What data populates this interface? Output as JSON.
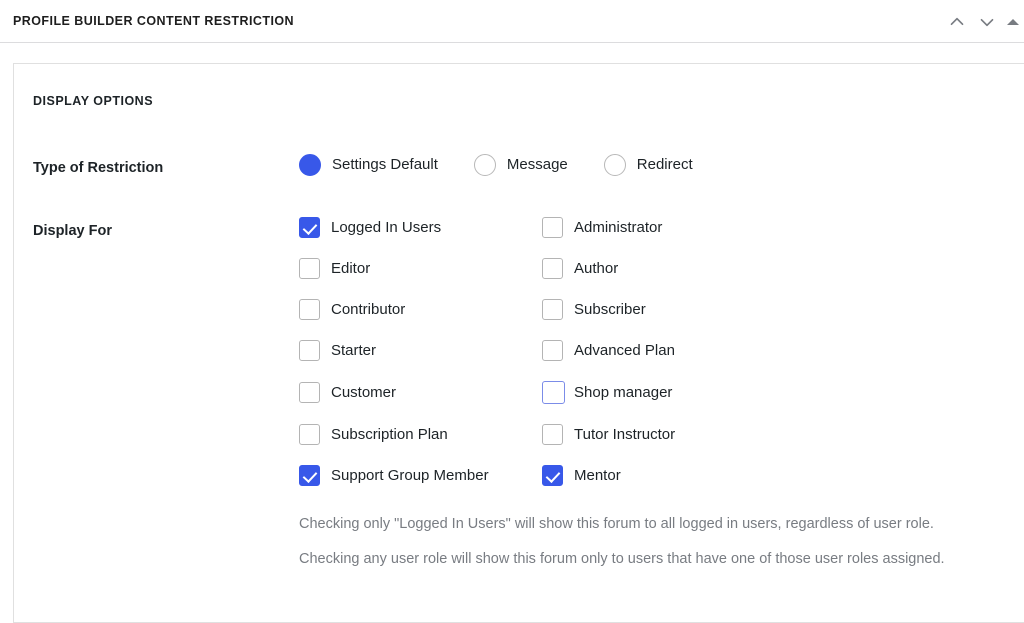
{
  "metabox": {
    "title": "PROFILE BUILDER CONTENT RESTRICTION",
    "controls": [
      {
        "name": "move-up-icon",
        "label": "Move up"
      },
      {
        "name": "move-down-icon",
        "label": "Move down"
      },
      {
        "name": "toggle-panel-icon",
        "label": "Toggle panel"
      }
    ]
  },
  "panel": {
    "section_heading": "DISPLAY OPTIONS",
    "restriction": {
      "label": "Type of Restriction",
      "options": [
        {
          "label": "Settings Default",
          "checked": true
        },
        {
          "label": "Message",
          "checked": false
        },
        {
          "label": "Redirect",
          "checked": false
        }
      ]
    },
    "display_for": {
      "label": "Display For",
      "roles": [
        {
          "label": "Logged In Users",
          "checked": true,
          "focused": false
        },
        {
          "label": "Administrator",
          "checked": false,
          "focused": false
        },
        {
          "label": "Editor",
          "checked": false,
          "focused": false
        },
        {
          "label": "Author",
          "checked": false,
          "focused": false
        },
        {
          "label": "Contributor",
          "checked": false,
          "focused": false
        },
        {
          "label": "Subscriber",
          "checked": false,
          "focused": false
        },
        {
          "label": "Starter",
          "checked": false,
          "focused": false
        },
        {
          "label": "Advanced Plan",
          "checked": false,
          "focused": false
        },
        {
          "label": "Customer",
          "checked": false,
          "focused": false
        },
        {
          "label": "Shop manager",
          "checked": false,
          "focused": true
        },
        {
          "label": "Subscription Plan",
          "checked": false,
          "focused": false
        },
        {
          "label": "Tutor Instructor",
          "checked": false,
          "focused": false
        },
        {
          "label": "Support Group Member",
          "checked": true,
          "focused": false
        },
        {
          "label": "Mentor",
          "checked": true,
          "focused": false
        }
      ],
      "help": [
        "Checking only \"Logged In Users\" will show this forum to all logged in users, regardless of user role.",
        "Checking any user role will show this forum only to users that have one of those user roles assigned."
      ]
    }
  },
  "colors": {
    "accent": "#3858e9",
    "focus_border": "#7b8ce8",
    "text": "#1d2327",
    "muted_text": "#787c82",
    "border": "#e0e0e0"
  }
}
